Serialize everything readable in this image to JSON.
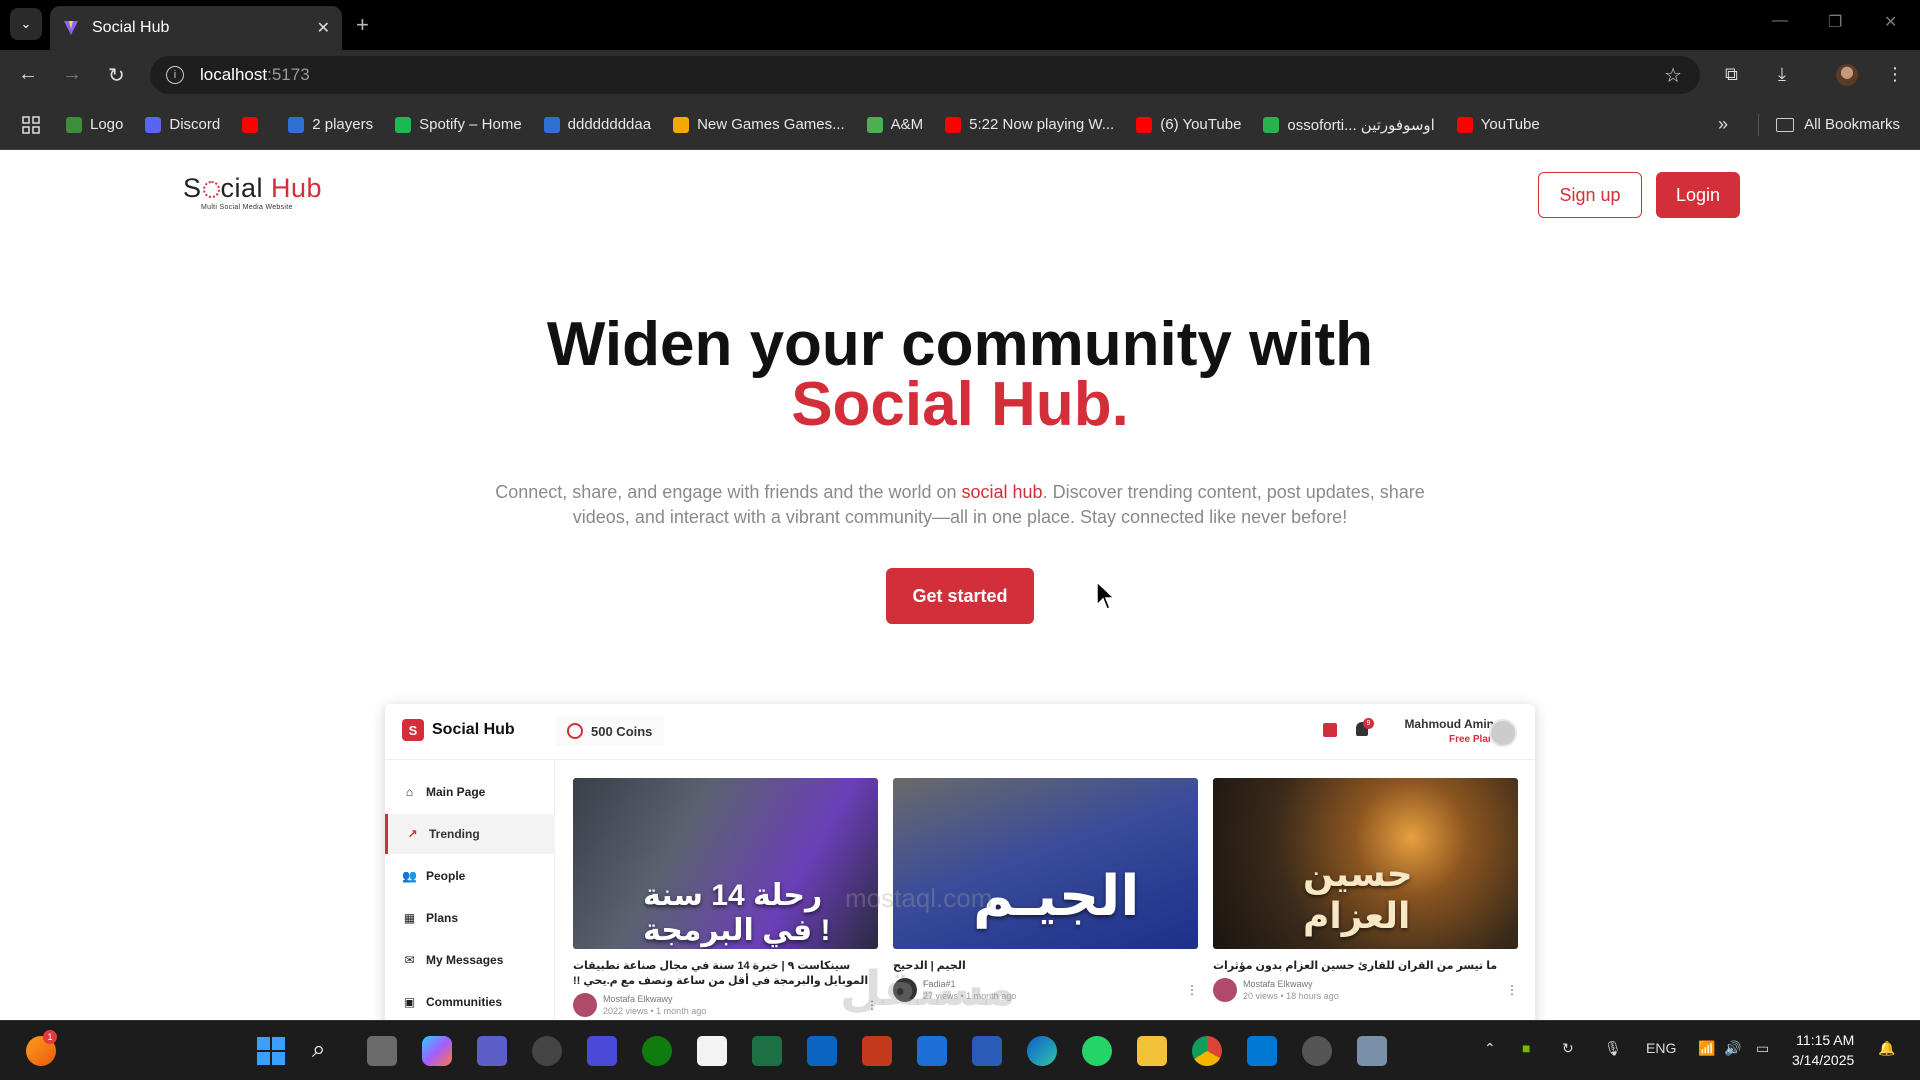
{
  "browser": {
    "tab_title": "Social Hub",
    "url_host": "localhost",
    "url_port": ":5173",
    "bookmarks": [
      {
        "label": "Logo",
        "color": "#3a8f3a"
      },
      {
        "label": "Discord",
        "color": "#5865f2"
      },
      {
        "label": "",
        "color": "#ff0000"
      },
      {
        "label": "2 players",
        "color": "#2f6fd0"
      },
      {
        "label": "Spotify – Home",
        "color": "#1db954"
      },
      {
        "label": "ddddddddaa",
        "color": "#2f6fd0"
      },
      {
        "label": "New Games Games...",
        "color": "#f2a900"
      },
      {
        "label": "A&M",
        "color": "#4caf50"
      },
      {
        "label": "5:22 Now playing W...",
        "color": "#ff0000"
      },
      {
        "label": "(6) YouTube",
        "color": "#ff0000"
      },
      {
        "label": "ossoforti... اوسوفورتين",
        "color": "#28b14c"
      },
      {
        "label": "YouTube",
        "color": "#ff0000"
      }
    ],
    "all_bookmarks": "All Bookmarks"
  },
  "header": {
    "logo_s": "S",
    "logo_cial": "cial",
    "logo_hub": " Hub",
    "logo_tagline": "Multi Social Media Website",
    "signup_label": "Sign up",
    "login_label": "Login"
  },
  "hero": {
    "title": "Widen your community with",
    "brand": "Social Hub.",
    "desc_before": "Connect, share, and engage with friends and the world on ",
    "desc_highlight": "social hub",
    "desc_after": ". Discover trending content, post updates, share videos, and interact with a vibrant community—all in one place. Stay connected like never before!",
    "cta_label": "Get started"
  },
  "preview": {
    "brand_mark": "S",
    "brand": "Social Hub",
    "coins": "500 Coins",
    "notif_count": "9",
    "user_name": "Mahmoud Amin",
    "user_plan": "Free Plan",
    "sidebar": [
      {
        "label": "Main Page",
        "icon": "home-icon",
        "glyph": "⌂",
        "active": false
      },
      {
        "label": "Trending",
        "icon": "trending-icon",
        "glyph": "↗",
        "active": true
      },
      {
        "label": "People",
        "icon": "people-icon",
        "glyph": "👥",
        "active": false
      },
      {
        "label": "Plans",
        "icon": "plans-icon",
        "glyph": "▦",
        "active": false
      },
      {
        "label": "My Messages",
        "icon": "messages-icon",
        "glyph": "✉",
        "active": false
      },
      {
        "label": "Communities",
        "icon": "communities-icon",
        "glyph": "▣",
        "active": false
      }
    ],
    "videos": [
      {
        "thumb_text": "رحلة 14 سنة في البرمجة !",
        "title": "سينكاست ٩ | خبرة 14 سنة في مجال صناعة تطبيقات الموبايل والبرمجة في أقل من ساعة ونصف مع م.يحي !!",
        "author": "Mostafa Elkwawy",
        "stats": "2022 views • 1 month ago"
      },
      {
        "thumb_text": "الجيـم",
        "title": "الجيم | الدحيح",
        "author": "Fadia#1",
        "stats": "27 views • 1 month ago"
      },
      {
        "thumb_text": "حسين العزام",
        "title": "ما تيسر من القران للقارئ حسين العزام بدون مؤثرات",
        "author": "Mostafa Elkwawy",
        "stats": "20 views • 18 hours ago"
      }
    ]
  },
  "watermark": {
    "arabic": "مستقل",
    "latin": "mostaql.com"
  },
  "taskbar": {
    "lang": "ENG",
    "time": "11:15 AM",
    "date": "3/14/2025",
    "badge": "1"
  }
}
